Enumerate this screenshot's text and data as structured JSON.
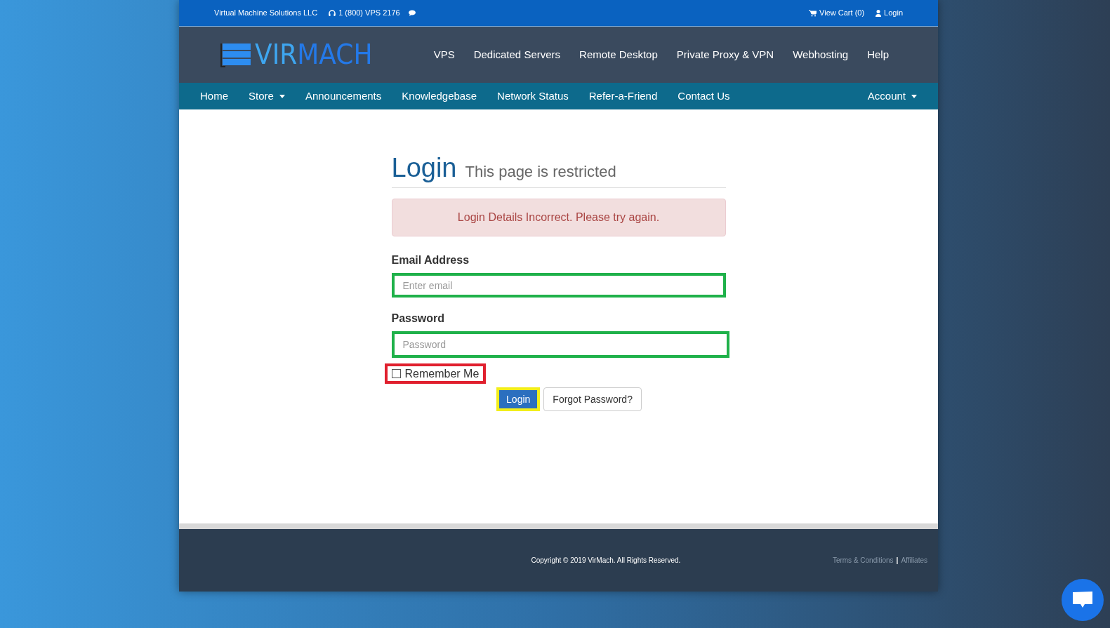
{
  "top_bar": {
    "company": "Virtual Machine Solutions LLC",
    "phone": "1 (800) VPS 2176",
    "cart": "View Cart (0)",
    "login": "Login"
  },
  "logo": {
    "part_1": "VIR",
    "part_2": "MACH"
  },
  "main_nav": [
    "VPS",
    "Dedicated Servers",
    "Remote Desktop",
    "Private Proxy & VPN",
    "Webhosting",
    "Help"
  ],
  "sub_nav": {
    "items": [
      {
        "label": "Home",
        "dropdown": false
      },
      {
        "label": "Store",
        "dropdown": true
      },
      {
        "label": "Announcements",
        "dropdown": false
      },
      {
        "label": "Knowledgebase",
        "dropdown": false
      },
      {
        "label": "Network Status",
        "dropdown": false
      },
      {
        "label": "Refer-a-Friend",
        "dropdown": false
      },
      {
        "label": "Contact Us",
        "dropdown": false
      }
    ],
    "account": {
      "label": "Account",
      "dropdown": true
    }
  },
  "login_form": {
    "title": "Login",
    "subtitle": "This page is restricted",
    "alert": "Login Details Incorrect. Please try again.",
    "email_label": "Email Address",
    "email": {
      "placeholder": "Enter email"
    },
    "password_label": "Password",
    "password": {
      "placeholder": "Password"
    },
    "remember": {
      "label": "Remember Me",
      "checked": false
    },
    "login_button": "Login",
    "forgot_button": "Forgot Password?"
  },
  "footer": {
    "copyright": "Copyright © 2019 VirMach. All Rights Reserved.",
    "links": [
      "Terms & Conditions",
      "Affiliates"
    ],
    "separator": "|"
  }
}
